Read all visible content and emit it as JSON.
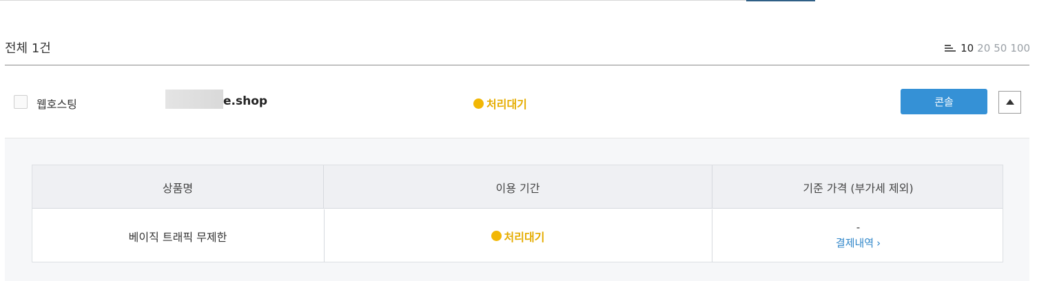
{
  "summary": {
    "label": "전체 1건"
  },
  "page_size": {
    "options": [
      "10",
      "20",
      "50",
      "100"
    ],
    "selected": "10"
  },
  "row": {
    "service_type": "웹호스팅",
    "domain_suffix": "e.shop",
    "status": "처리대기",
    "console_label": "콘솔"
  },
  "detail_table": {
    "headers": [
      "상품명",
      "이용 기간",
      "기준 가격 (부가세 제외)"
    ],
    "rows": [
      {
        "product": "베이직 트래픽 무제한",
        "period_status": "처리대기",
        "price": "-",
        "payment_link": "결제내역"
      }
    ]
  },
  "colors": {
    "accent": "#3591d6",
    "status_pending": "#f2b705",
    "link": "#2f86c9"
  }
}
